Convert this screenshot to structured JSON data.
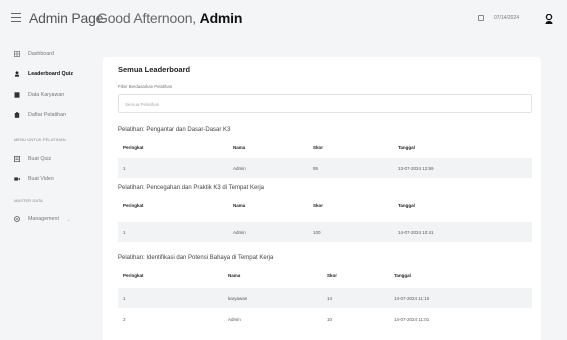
{
  "header": {
    "app_title": "Admin Page",
    "greeting": "Good Afternoon,",
    "user_name": "Admin",
    "date_value": "07/14/2024"
  },
  "sidebar": {
    "items": [
      {
        "label": "Dashboard",
        "icon": "grid-icon"
      },
      {
        "label": "Leaderboard Quiz",
        "icon": "trophy-icon",
        "active": true
      },
      {
        "label": "Data Karyawan",
        "icon": "id-card-icon"
      },
      {
        "label": "Daftar Pelatihan",
        "icon": "clipboard-icon"
      }
    ],
    "section_training": "MENU UNTUK PELATIHAN",
    "training_items": [
      {
        "label": "Buat Quiz",
        "icon": "quiz-icon"
      },
      {
        "label": "Buat Video",
        "icon": "video-icon"
      }
    ],
    "section_master": "MASTER DATA",
    "master_items": [
      {
        "label": "Management",
        "icon": "gear-icon"
      }
    ]
  },
  "card": {
    "title": "Semua Leaderboard",
    "filter_label": "Filter Berdasarkan Pelatihan",
    "filter_placeholder": "Semua Pelatihan",
    "columns": {
      "rank": "Peringkat",
      "name": "Nama",
      "score": "Skor",
      "date": "Tanggal"
    },
    "sections": [
      {
        "heading": "Pelatihan: Pengantar dan Dasar-Dasar K3",
        "rows": [
          {
            "rank": "1",
            "name": "Admin",
            "score": "95",
            "date": "13-07-2024 12:59"
          }
        ]
      },
      {
        "heading": "Pelatihan: Pencegahan dan Praktik K3 di Tempat Kerja",
        "rows": [
          {
            "rank": "1",
            "name": "Admin",
            "score": "100",
            "date": "14-07-2024 10:41"
          }
        ]
      },
      {
        "heading": "Pelatihan: Identifikasi dan Potensi Bahaya di Tempat Kerja",
        "rows": [
          {
            "rank": "1",
            "name": "karyawan",
            "score": "14",
            "date": "14-07-2024 11:10"
          },
          {
            "rank": "2",
            "name": "Admin",
            "score": "10",
            "date": "14-07-2024 11:01"
          }
        ]
      }
    ]
  },
  "colors": {
    "accent": "#222222",
    "row_shade": "#f2f3f5",
    "background": "#f4f5f7"
  }
}
